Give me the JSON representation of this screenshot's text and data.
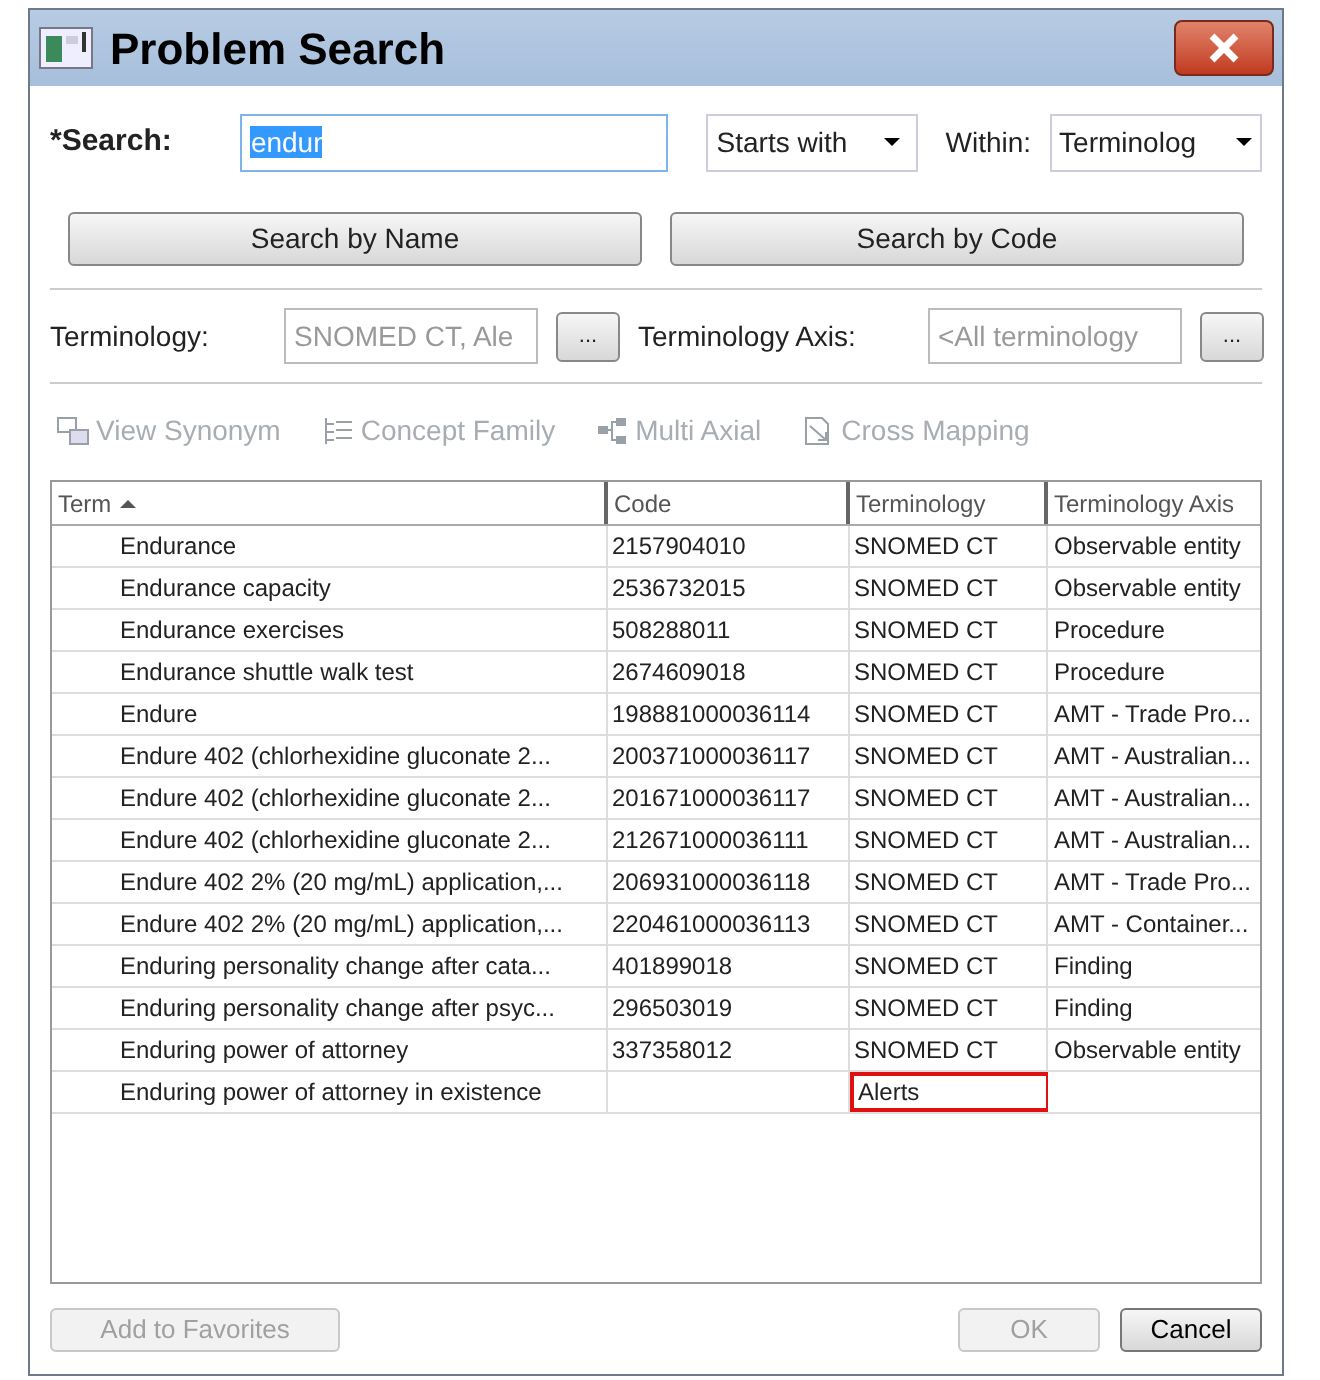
{
  "window": {
    "title": "Problem Search"
  },
  "search": {
    "label": "*Search:",
    "value": "endur",
    "match": "Starts with",
    "within_label": "Within:",
    "within": "Terminolog"
  },
  "search_buttons": [
    "Search by Name",
    "Search by Code"
  ],
  "filters": [
    {
      "label": "Terminology:",
      "value": "SNOMED CT, Ale",
      "button": "..."
    },
    {
      "label": "Terminology Axis:",
      "value": "<All terminology",
      "button": "..."
    }
  ],
  "toolbar": [
    {
      "kind": "synonym",
      "label": "View Synonym",
      "disabled": true
    },
    {
      "kind": "family",
      "label": "Concept Family",
      "disabled": true
    },
    {
      "kind": "axial",
      "label": "Multi Axial",
      "disabled": true
    },
    {
      "kind": "mapping",
      "label": "Cross Mapping",
      "disabled": true
    }
  ],
  "table": {
    "columns": [
      {
        "label": "Term",
        "sorted": true
      },
      {
        "label": "Code",
        "sorted": false
      },
      {
        "label": "Terminology",
        "sorted": false
      },
      {
        "label": "Terminology Axis",
        "sorted": false
      }
    ],
    "rows": [
      {
        "term": "Endurance",
        "code": "2157904010",
        "terminology": "SNOMED CT",
        "axis": "Observable entity",
        "highlighted": false
      },
      {
        "term": "Endurance capacity",
        "code": "2536732015",
        "terminology": "SNOMED CT",
        "axis": "Observable entity",
        "highlighted": false
      },
      {
        "term": "Endurance exercises",
        "code": "508288011",
        "terminology": "SNOMED CT",
        "axis": "Procedure",
        "highlighted": false
      },
      {
        "term": "Endurance shuttle walk test",
        "code": "2674609018",
        "terminology": "SNOMED CT",
        "axis": "Procedure",
        "highlighted": false
      },
      {
        "term": "Endure",
        "code": "198881000036114",
        "terminology": "SNOMED CT",
        "axis": "AMT - Trade Pro...",
        "highlighted": false
      },
      {
        "term": "Endure 402 (chlorhexidine gluconate 2...",
        "code": "200371000036117",
        "terminology": "SNOMED CT",
        "axis": "AMT - Australian...",
        "highlighted": false
      },
      {
        "term": "Endure 402 (chlorhexidine gluconate 2...",
        "code": "201671000036117",
        "terminology": "SNOMED CT",
        "axis": "AMT - Australian...",
        "highlighted": false
      },
      {
        "term": "Endure 402 (chlorhexidine gluconate 2...",
        "code": "212671000036111",
        "terminology": "SNOMED CT",
        "axis": "AMT - Australian...",
        "highlighted": false
      },
      {
        "term": "Endure 402 2% (20 mg/mL) application,...",
        "code": "206931000036118",
        "terminology": "SNOMED CT",
        "axis": "AMT - Trade Pro...",
        "highlighted": false
      },
      {
        "term": "Endure 402 2% (20 mg/mL) application,...",
        "code": "220461000036113",
        "terminology": "SNOMED CT",
        "axis": "AMT - Container...",
        "highlighted": false
      },
      {
        "term": "Enduring personality change after cata...",
        "code": "401899018",
        "terminology": "SNOMED CT",
        "axis": "Finding",
        "highlighted": false
      },
      {
        "term": "Enduring personality change after psyc...",
        "code": "296503019",
        "terminology": "SNOMED CT",
        "axis": "Finding",
        "highlighted": false
      },
      {
        "term": "Enduring power of attorney",
        "code": "337358012",
        "terminology": "SNOMED CT",
        "axis": "Observable entity",
        "highlighted": false
      },
      {
        "term": "Enduring power of attorney in existence",
        "terminology": "Alerts",
        "highlighted": true
      }
    ]
  },
  "footer": [
    {
      "kind": "left",
      "label": "Add to Favorites",
      "disabled": true
    },
    {
      "kind": "right",
      "label": "OK",
      "disabled": true
    },
    {
      "kind": "right",
      "label": "Cancel",
      "disabled": false
    }
  ]
}
